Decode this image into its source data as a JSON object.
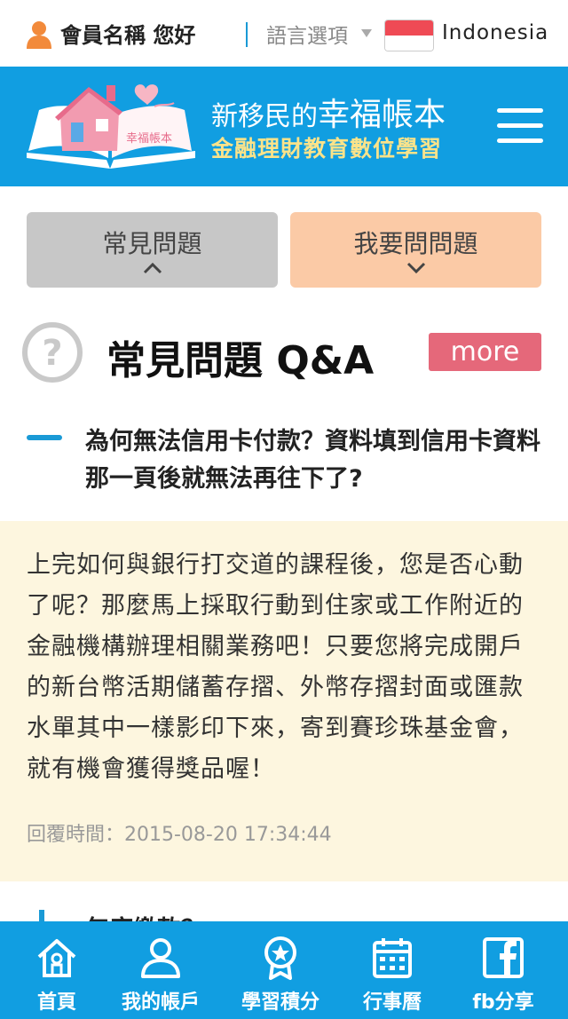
{
  "topbar": {
    "greeting": "會員名稱 您好",
    "language_label": "語言選項",
    "language_name": "Indonesia"
  },
  "header": {
    "logo_text": "幸福帳本",
    "title": "新移民的幸福帳本",
    "subtitle": "金融理財教育數位學習"
  },
  "tabs": [
    {
      "label": "常見問題"
    },
    {
      "label": "我要問問題"
    }
  ],
  "faq": {
    "section_title": "常見問題 Q&A",
    "more_label": "more",
    "question": "為何無法信用卡付款？資料填到信用卡資料那一頁後就無法再往下了?",
    "answer": "上完如何與銀行打交道的課程後，您是否心動了呢？那麼馬上採取行動到住家或工作附近的金融機構辦理相關業務吧！只要您將完成開戶的新台幣活期儲蓄存摺、外幣存摺封面或匯款水單其中一樣影印下來，寄到賽珍珠基金會，就有機會獲得獎品喔！",
    "reply_time": "回覆時間：2015-08-20 17:34:44",
    "next_question_partial": "年度繳款？"
  },
  "bottom_nav": [
    {
      "label": "首頁",
      "icon": "home-icon"
    },
    {
      "label": "我的帳戶",
      "icon": "user-icon"
    },
    {
      "label": "學習積分",
      "icon": "medal-icon"
    },
    {
      "label": "行事曆",
      "icon": "calendar-icon"
    },
    {
      "label": "fb分享",
      "icon": "facebook-icon"
    }
  ],
  "colors": {
    "brand_blue": "#119ee1",
    "accent_pink": "#e5687a",
    "tab_active": "#c7c7c7",
    "tab_ask": "#fbcaa6",
    "answer_bg": "#fdf6df",
    "subtitle_yellow": "#fbe38a"
  }
}
